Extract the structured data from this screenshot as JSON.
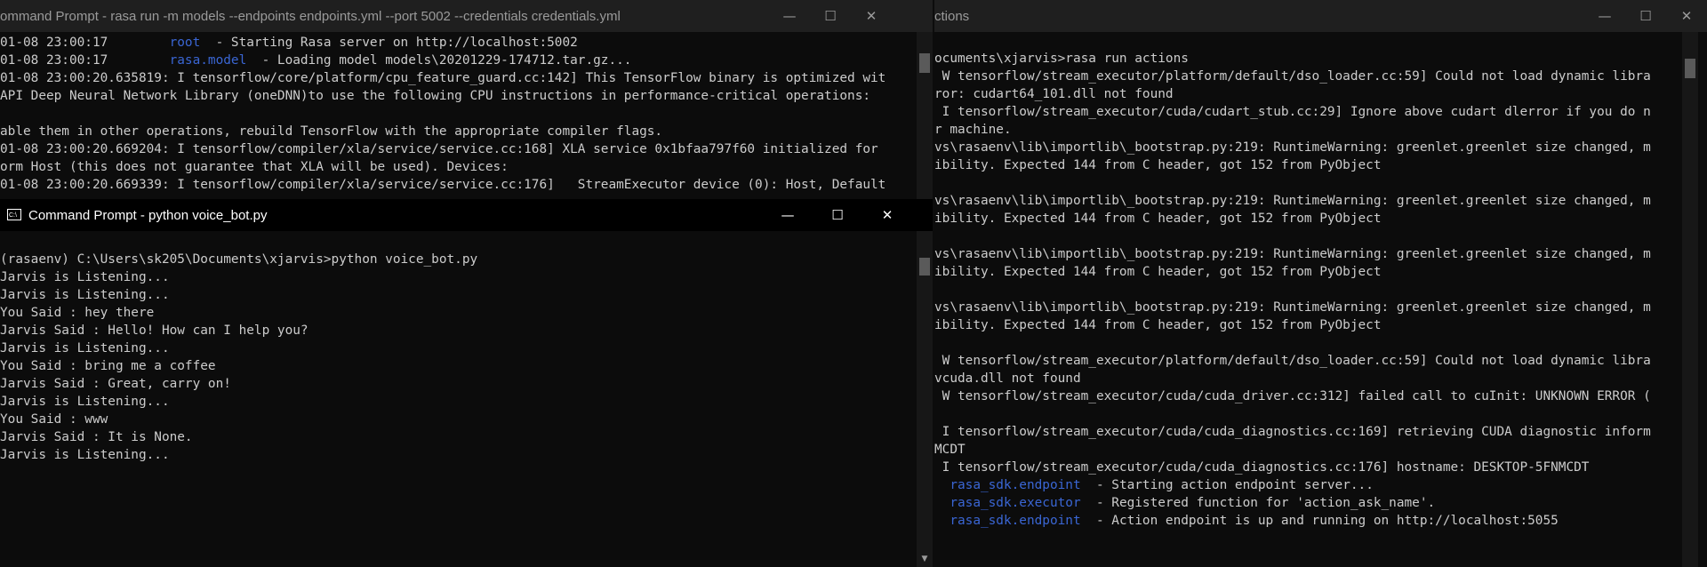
{
  "windows": {
    "rasa_server": {
      "title": "ommand Prompt - rasa  run -m models --endpoints endpoints.yml --port 5002 --credentials credentials.yml",
      "controls": [
        "—",
        "☐",
        "✕"
      ],
      "lines": [
        {
          "pre": "01-08 23:00:17        ",
          "blue": "root",
          "post": "  - Starting Rasa server on http://localhost:5002"
        },
        {
          "pre": "01-08 23:00:17        ",
          "blue": "rasa.model",
          "post": "  - Loading model models\\20201229-174712.tar.gz..."
        },
        {
          "text": "01-08 23:00:20.635819: I tensorflow/core/platform/cpu_feature_guard.cc:142] This TensorFlow binary is optimized wit"
        },
        {
          "text": "API Deep Neural Network Library (oneDNN)to use the following CPU instructions in performance-critical operations:"
        },
        {
          "text": ""
        },
        {
          "text": "able them in other operations, rebuild TensorFlow with the appropriate compiler flags."
        },
        {
          "text": "01-08 23:00:20.669204: I tensorflow/compiler/xla/service/service.cc:168] XLA service 0x1bfaa797f60 initialized for"
        },
        {
          "text": "orm Host (this does not guarantee that XLA will be used). Devices:"
        },
        {
          "text": "01-08 23:00:20.669339: I tensorflow/compiler/xla/service/service.cc:176]   StreamExecutor device (0): Host, Default"
        }
      ]
    },
    "voice_bot": {
      "title": "Command Prompt - python  voice_bot.py",
      "icon_text": "C:\\",
      "controls": [
        "—",
        "☐",
        "✕"
      ],
      "lines": [
        "",
        "(rasaenv) C:\\Users\\sk205\\Documents\\xjarvis>python voice_bot.py",
        "Jarvis is Listening...",
        "Jarvis is Listening...",
        "You Said : hey there",
        "Jarvis Said : Hello! How can I help you?",
        "Jarvis is Listening...",
        "You Said : bring me a coffee",
        "Jarvis Said : Great, carry on!",
        "Jarvis is Listening...",
        "You Said : www",
        "Jarvis Said : It is None.",
        "Jarvis is Listening..."
      ]
    },
    "rasa_actions": {
      "title": "ctions",
      "controls": [
        "—",
        "☐",
        "✕"
      ],
      "lines": [
        {
          "text": ""
        },
        {
          "text": "ocuments\\xjarvis>rasa run actions"
        },
        {
          "text": " W tensorflow/stream_executor/platform/default/dso_loader.cc:59] Could not load dynamic libra"
        },
        {
          "text": "ror: cudart64_101.dll not found"
        },
        {
          "text": " I tensorflow/stream_executor/cuda/cudart_stub.cc:29] Ignore above cudart dlerror if you do n"
        },
        {
          "text": "r machine."
        },
        {
          "text": "vs\\rasaenv\\lib\\importlib\\_bootstrap.py:219: RuntimeWarning: greenlet.greenlet size changed, m"
        },
        {
          "text": "ibility. Expected 144 from C header, got 152 from PyObject"
        },
        {
          "text": ""
        },
        {
          "text": "vs\\rasaenv\\lib\\importlib\\_bootstrap.py:219: RuntimeWarning: greenlet.greenlet size changed, m"
        },
        {
          "text": "ibility. Expected 144 from C header, got 152 from PyObject"
        },
        {
          "text": ""
        },
        {
          "text": "vs\\rasaenv\\lib\\importlib\\_bootstrap.py:219: RuntimeWarning: greenlet.greenlet size changed, m"
        },
        {
          "text": "ibility. Expected 144 from C header, got 152 from PyObject"
        },
        {
          "text": ""
        },
        {
          "text": "vs\\rasaenv\\lib\\importlib\\_bootstrap.py:219: RuntimeWarning: greenlet.greenlet size changed, m"
        },
        {
          "text": "ibility. Expected 144 from C header, got 152 from PyObject"
        },
        {
          "text": ""
        },
        {
          "text": " W tensorflow/stream_executor/platform/default/dso_loader.cc:59] Could not load dynamic libra"
        },
        {
          "text": "vcuda.dll not found"
        },
        {
          "text": " W tensorflow/stream_executor/cuda/cuda_driver.cc:312] failed call to cuInit: UNKNOWN ERROR ("
        },
        {
          "text": ""
        },
        {
          "text": " I tensorflow/stream_executor/cuda/cuda_diagnostics.cc:169] retrieving CUDA diagnostic inform"
        },
        {
          "text": "MCDT"
        },
        {
          "text": " I tensorflow/stream_executor/cuda/cuda_diagnostics.cc:176] hostname: DESKTOP-5FNMCDT"
        },
        {
          "pre": "  ",
          "blue": "rasa_sdk.endpoint",
          "post": "  - Starting action endpoint server..."
        },
        {
          "pre": "  ",
          "blue": "rasa_sdk.executor",
          "post": "  - Registered function for 'action_ask_name'."
        },
        {
          "pre": "  ",
          "blue": "rasa_sdk.endpoint",
          "post": "  - Action endpoint is up and running on http://localhost:5055"
        }
      ]
    }
  },
  "colors": {
    "console_bg": "#0c0c0c",
    "console_text": "#cccccc",
    "logger_name": "#3a66d4",
    "active_titlebar": "#000000",
    "inactive_titlebar": "#1f1f1f"
  }
}
